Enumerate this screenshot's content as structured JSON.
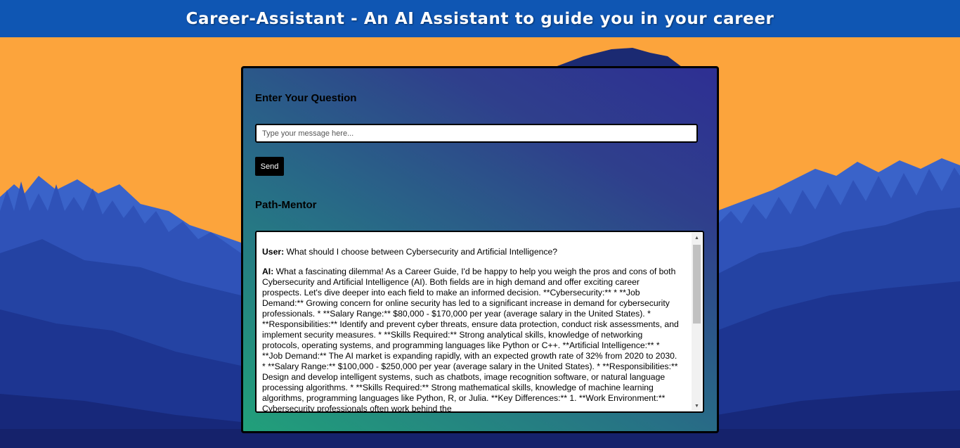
{
  "header": {
    "title": "Career-Assistant - An AI Assistant to guide you in your career"
  },
  "question_section": {
    "label": "Enter Your Question",
    "input_placeholder": "Type your message here...",
    "input_value": "",
    "send_label": "Send"
  },
  "mentor_section": {
    "label": "Path-Mentor"
  },
  "chat": {
    "messages": [
      {
        "speaker": "User:",
        "text": " What should I choose between Cybersecurity and Artificial Intelligence?"
      },
      {
        "speaker": "AI:",
        "text": " What a fascinating dilemma! As a Career Guide, I'd be happy to help you weigh the pros and cons of both Cybersecurity and Artificial Intelligence (AI). Both fields are in high demand and offer exciting career prospects. Let's dive deeper into each field to make an informed decision. **Cybersecurity:** * **Job Demand:** Growing concern for online security has led to a significant increase in demand for cybersecurity professionals. * **Salary Range:** $80,000 - $170,000 per year (average salary in the United States). * **Responsibilities:** Identify and prevent cyber threats, ensure data protection, conduct risk assessments, and implement security measures. * **Skills Required:** Strong analytical skills, knowledge of networking protocols, operating systems, and programming languages like Python or C++. **Artificial Intelligence:** * **Job Demand:** The AI market is expanding rapidly, with an expected growth rate of 32% from 2020 to 2030. * **Salary Range:** $100,000 - $250,000 per year (average salary in the United States). * **Responsibilities:** Design and develop intelligent systems, such as chatbots, image recognition software, or natural language processing algorithms. * **Skills Required:** Strong mathematical skills, knowledge of machine learning algorithms, programming languages like Python, R, or Julia. **Key Differences:** 1. **Work Environment:** Cybersecurity professionals often work behind the"
      }
    ]
  },
  "colors": {
    "header_bg": "#0f56b3",
    "sky": "#fca43c",
    "panel_gradient_start": "#21a07a",
    "panel_gradient_end": "#2e2f93",
    "button_bg": "#000000"
  },
  "icons": {
    "scroll_up": "triangle-up-icon",
    "scroll_down": "triangle-down-icon"
  }
}
